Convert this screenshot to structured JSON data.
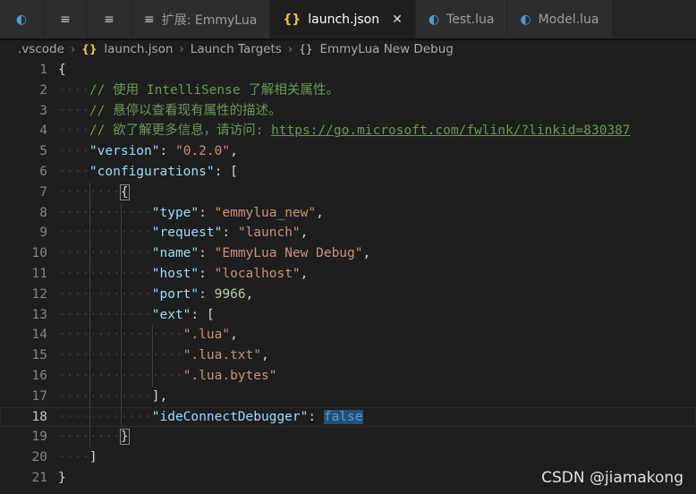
{
  "tabs": [
    {
      "label": "",
      "icon": "moon-icon",
      "type": "lua"
    },
    {
      "label": "",
      "icon": "menu-icon",
      "type": "menu"
    },
    {
      "label": "",
      "icon": "menu-icon",
      "type": "menu"
    },
    {
      "label": "扩展: EmmyLua",
      "icon": "menu-icon",
      "type": "menu"
    },
    {
      "label": "launch.json",
      "icon": "json-icon",
      "type": "json",
      "active": true
    },
    {
      "label": "Test.lua",
      "icon": "moon-icon",
      "type": "lua"
    },
    {
      "label": "Model.lua",
      "icon": "moon-icon",
      "type": "lua"
    }
  ],
  "breadcrumb": {
    "root": ".vscode",
    "file": "launch.json",
    "section": "Launch Targets",
    "item": "EmmyLua New Debug"
  },
  "lines": [
    {
      "n": "1",
      "indent": 0,
      "tokens": [
        [
          "p",
          "{"
        ]
      ]
    },
    {
      "n": "2",
      "indent": 1,
      "tokens": [
        [
          "comment",
          "// 使用 IntelliSense 了解相关属性。"
        ]
      ]
    },
    {
      "n": "3",
      "indent": 1,
      "tokens": [
        [
          "comment",
          "// 悬停以查看现有属性的描述。"
        ]
      ]
    },
    {
      "n": "4",
      "indent": 1,
      "tokens": [
        [
          "comment",
          "// 欲了解更多信息，请访问: "
        ],
        [
          "link",
          "https://go.microsoft.com/fwlink/?linkid=830387"
        ]
      ]
    },
    {
      "n": "5",
      "indent": 1,
      "tokens": [
        [
          "key",
          "\"version\""
        ],
        [
          "p",
          ": "
        ],
        [
          "str",
          "\"0.2.0\""
        ],
        [
          "p",
          ","
        ]
      ]
    },
    {
      "n": "6",
      "indent": 1,
      "tokens": [
        [
          "key",
          "\"configurations\""
        ],
        [
          "p",
          ": ["
        ]
      ]
    },
    {
      "n": "7",
      "indent": 2,
      "tokens": [
        [
          "bracket",
          "{"
        ]
      ]
    },
    {
      "n": "8",
      "indent": 3,
      "tokens": [
        [
          "key",
          "\"type\""
        ],
        [
          "p",
          ": "
        ],
        [
          "str",
          "\"emmylua_new\""
        ],
        [
          "p",
          ","
        ]
      ]
    },
    {
      "n": "9",
      "indent": 3,
      "tokens": [
        [
          "key",
          "\"request\""
        ],
        [
          "p",
          ": "
        ],
        [
          "str",
          "\"launch\""
        ],
        [
          "p",
          ","
        ]
      ]
    },
    {
      "n": "10",
      "indent": 3,
      "tokens": [
        [
          "key",
          "\"name\""
        ],
        [
          "p",
          ": "
        ],
        [
          "str",
          "\"EmmyLua New Debug\""
        ],
        [
          "p",
          ","
        ]
      ]
    },
    {
      "n": "11",
      "indent": 3,
      "tokens": [
        [
          "key",
          "\"host\""
        ],
        [
          "p",
          ": "
        ],
        [
          "str",
          "\"localhost\""
        ],
        [
          "p",
          ","
        ]
      ]
    },
    {
      "n": "12",
      "indent": 3,
      "tokens": [
        [
          "key",
          "\"port\""
        ],
        [
          "p",
          ": "
        ],
        [
          "num",
          "9966"
        ],
        [
          "p",
          ","
        ]
      ]
    },
    {
      "n": "13",
      "indent": 3,
      "tokens": [
        [
          "key",
          "\"ext\""
        ],
        [
          "p",
          ": ["
        ]
      ]
    },
    {
      "n": "14",
      "indent": 4,
      "tokens": [
        [
          "str",
          "\".lua\""
        ],
        [
          "p",
          ","
        ]
      ]
    },
    {
      "n": "15",
      "indent": 4,
      "tokens": [
        [
          "str",
          "\".lua.txt\""
        ],
        [
          "p",
          ","
        ]
      ]
    },
    {
      "n": "16",
      "indent": 4,
      "tokens": [
        [
          "str",
          "\".lua.bytes\""
        ]
      ]
    },
    {
      "n": "17",
      "indent": 3,
      "tokens": [
        [
          "p",
          "],"
        ]
      ]
    },
    {
      "n": "18",
      "indent": 3,
      "current": true,
      "tokens": [
        [
          "key",
          "\"ideConnectDebugger\""
        ],
        [
          "p",
          ": "
        ],
        [
          "bool",
          "false"
        ]
      ]
    },
    {
      "n": "19",
      "indent": 2,
      "tokens": [
        [
          "bracket",
          "}"
        ]
      ]
    },
    {
      "n": "20",
      "indent": 1,
      "tokens": [
        [
          "p",
          "]"
        ]
      ]
    },
    {
      "n": "21",
      "indent": 0,
      "tokens": [
        [
          "p",
          "}"
        ]
      ]
    }
  ],
  "watermark": "CSDN @jiamakong"
}
